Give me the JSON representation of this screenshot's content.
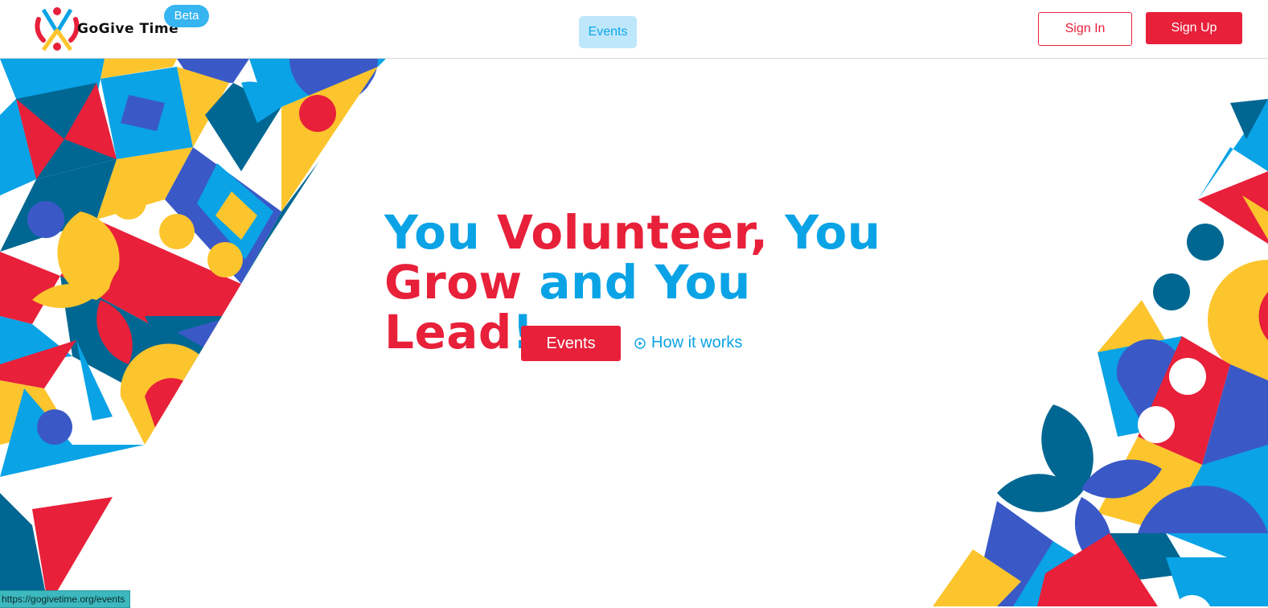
{
  "header": {
    "brand": "GoGive Time",
    "beta_badge": "Beta",
    "nav_events": "Events",
    "sign_in": "Sign In",
    "sign_up": "Sign Up"
  },
  "hero": {
    "headline": [
      {
        "text": "You ",
        "color": "blue"
      },
      {
        "text": "Volunteer, ",
        "color": "red"
      },
      {
        "text": "You ",
        "color": "blue"
      },
      {
        "text": "Grow ",
        "color": "red"
      },
      {
        "text": "and You ",
        "color": "blue"
      },
      {
        "text": "Lead",
        "color": "red"
      },
      {
        "text": "!",
        "color": "blue"
      }
    ],
    "events_button": "Events",
    "how_it_works": "How it works"
  },
  "status_bar": {
    "url": "https://gogivetime.org/events"
  },
  "colors": {
    "red": "#e8203a",
    "blue": "#0aa3e6",
    "light_blue": "#bfe7fb",
    "navy": "#006792",
    "indigo": "#3a59c7",
    "yellow": "#fdc52d"
  },
  "icons": [
    "gogive-logo-icon",
    "play-circle-icon"
  ]
}
